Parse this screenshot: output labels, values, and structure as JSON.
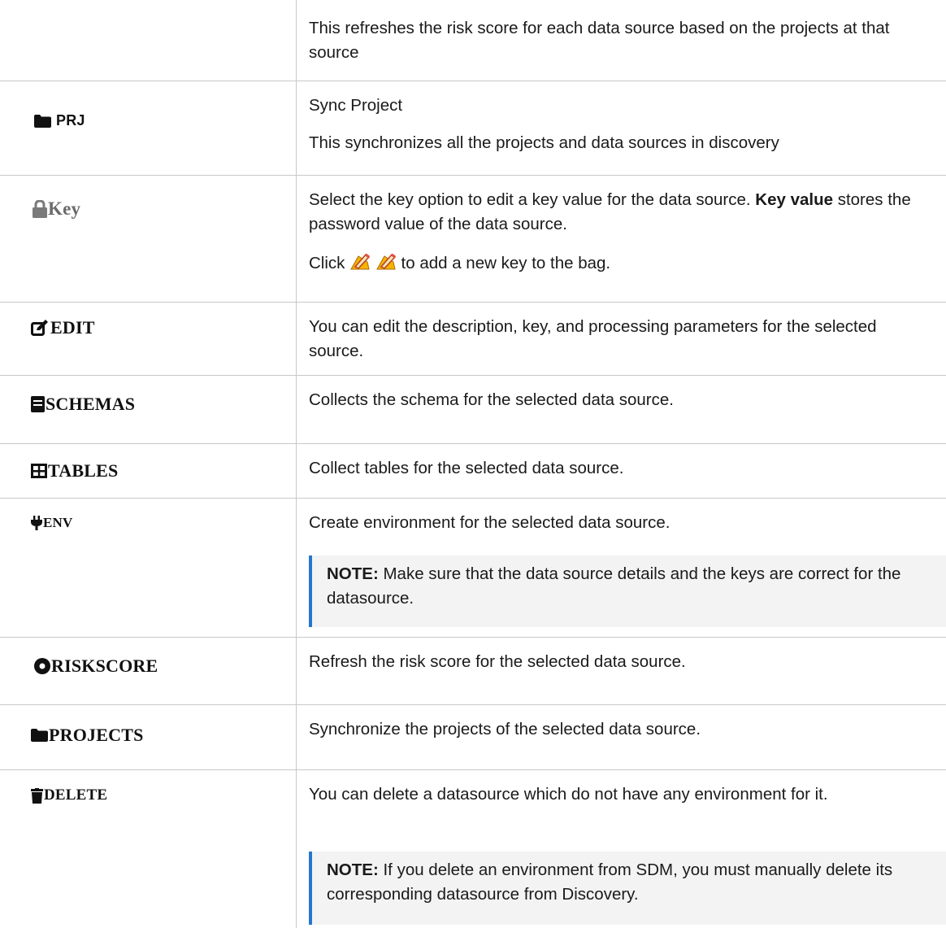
{
  "rows": {
    "refresh": {
      "text": "This refreshes the risk score for each data source based on the projects at that source"
    },
    "prj": {
      "button_label": "PRJ",
      "icon": "folder-icon",
      "title": "Sync Project",
      "text": "This synchronizes all the projects and data sources in discovery"
    },
    "key": {
      "button_label": "Key",
      "icon": "lock-icon",
      "text_pre": "Select the key option to edit a key value for the data source. ",
      "text_bold": "Key value",
      "text_post": " stores the password value of the data source.",
      "click_pre": "Click",
      "click_post": " to add a new key to the bag."
    },
    "edit": {
      "button_label": "EDIT",
      "icon": "edit-icon",
      "text": "You can edit the description, key, and processing parameters for the selected source."
    },
    "schemas": {
      "button_label": "SCHEMAS",
      "icon": "book-icon",
      "text": "Collects the schema for the selected data source."
    },
    "tables": {
      "button_label": "TABLES",
      "icon": "table-icon",
      "text": "Collect tables for the selected data source."
    },
    "env": {
      "button_label": "ENV",
      "icon": "plug-icon",
      "text": "Create environment for the selected data source.",
      "note_label": "NOTE:",
      "note_text": " Make sure that the data source details and the keys are correct for the datasource."
    },
    "riskscore": {
      "button_label": "RISKSCORE",
      "icon": "circle-icon",
      "text": "Refresh the risk score for the selected data source."
    },
    "projects": {
      "button_label": "PROJECTS",
      "icon": "folder-icon",
      "text": "Synchronize the projects of the selected data source."
    },
    "delete": {
      "button_label": "DELETE",
      "icon": "trash-icon",
      "text": "You can delete a datasource which do not have any environment for it.",
      "note_label": "NOTE:",
      "note_text": " If you delete an environment from SDM, you must manually delete its corresponding datasource from Discovery."
    }
  },
  "colors": {
    "note_accent": "#2477d0",
    "note_bg": "#f3f3f3",
    "border": "#c8c8c8"
  }
}
